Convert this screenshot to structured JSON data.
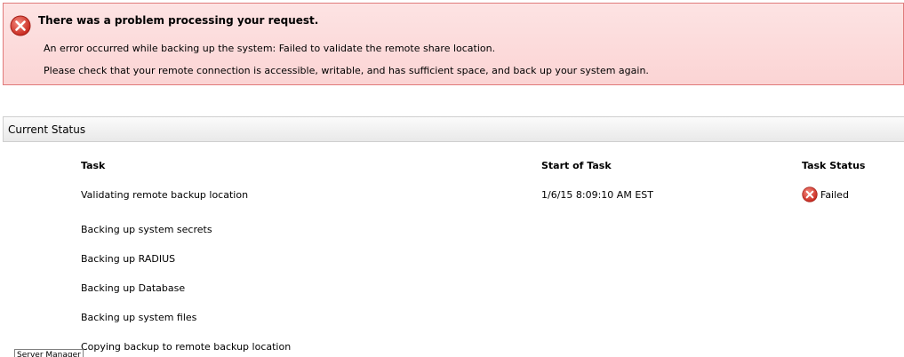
{
  "alert": {
    "title": "There was a problem processing your request.",
    "message_1": "An error occurred while backing up the system: Failed to validate the remote share location.",
    "message_2": "Please check that your remote connection is accessible, writable, and has sufficient space, and back up your system again.",
    "icon": "error-circle-x-icon",
    "color_border": "#e07a7a",
    "color_background": "#fbd9d9",
    "icon_color": "#d9463f"
  },
  "status_section": {
    "title": "Current Status",
    "columns": {
      "task": "Task",
      "start": "Start of Task",
      "status": "Task Status"
    },
    "rows": [
      {
        "task": "Validating remote backup location",
        "start": "1/6/15 8:09:10 AM EST",
        "status": "Failed",
        "status_icon": "error-circle-x-icon"
      },
      {
        "task": "Backing up system secrets",
        "start": "",
        "status": ""
      },
      {
        "task": "Backing up RADIUS",
        "start": "",
        "status": ""
      },
      {
        "task": "Backing up Database",
        "start": "",
        "status": ""
      },
      {
        "task": "Backing up system files",
        "start": "",
        "status": ""
      },
      {
        "task": "Copying backup to remote backup location",
        "start": "",
        "status": ""
      }
    ]
  },
  "taskbar": {
    "label": "Server Manager"
  }
}
